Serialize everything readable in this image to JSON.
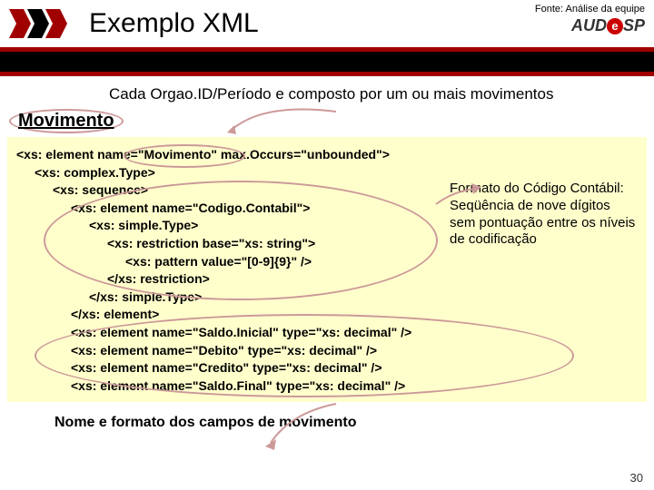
{
  "header": {
    "title": "Exemplo XML",
    "fonte": "Fonte: Análise da equipe",
    "brand_pre": "AUD",
    "brand_e": "e",
    "brand_post": "SP"
  },
  "subtitle": "Cada Orgao.ID/Período e composto por um ou mais movimentos",
  "section": "Movimento",
  "code": {
    "l1a": "<xs: element name=",
    "l1b": "\"Movimento\"",
    "l1c": " max.Occurs=",
    "l1d": "\"unbounded\"",
    "l1e": ">",
    "l2": "<xs: complex.Type>",
    "l3": "<xs: sequence>",
    "l4a": "<xs: element name=",
    "l4b": "\"Codigo.Contabil\"",
    "l4c": ">",
    "l5": "<xs: simple.Type>",
    "l6a": "<xs: restriction base=",
    "l6b": "\"xs: string\"",
    "l6c": ">",
    "l7a": "<xs: pattern value=",
    "l7b": "\"[0-9]{9}\"",
    "l7c": " />",
    "l8": "</xs: restriction>",
    "l9": "</xs: simple.Type>",
    "l10": "</xs: element>",
    "l11a": "<xs: element name=",
    "l11b": "\"Saldo.Inicial\"",
    "l11c": " type=",
    "l11d": "\"xs: decimal\"",
    "l11e": " />",
    "l12a": "<xs: element name=",
    "l12b": "\"Debito\"",
    "l12c": " type=",
    "l12d": "\"xs: decimal\"",
    "l12e": " />",
    "l13a": "<xs: element name=",
    "l13b": "\"Credito\"",
    "l13c": " type=",
    "l13d": "\"xs: decimal\"",
    "l13e": " />",
    "l14a": "<xs: element name=",
    "l14b": "\"Saldo.Final\"",
    "l14c": " type=",
    "l14d": "\"xs: decimal\"",
    "l14e": " />"
  },
  "annotation": "Formato do Código Contábil: Seqüência de nove dígitos sem pontuação entre os níveis de codificação",
  "caption": "Nome e formato dos campos de movimento",
  "page": "30"
}
